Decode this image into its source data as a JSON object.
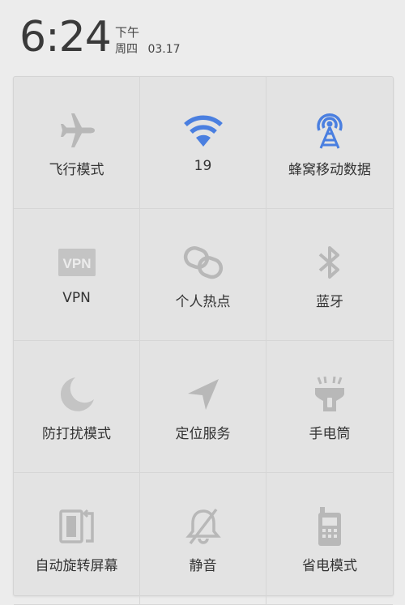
{
  "status": {
    "time": "6:24",
    "ampm": "下午",
    "weekday": "周四",
    "date": "03.17"
  },
  "colors": {
    "active": "#4a7fe0",
    "inactive": "#b8b8b8"
  },
  "tiles": [
    {
      "label": "飞行模式",
      "icon": "airplane-icon",
      "active": false
    },
    {
      "label": "19",
      "icon": "wifi-icon",
      "active": true
    },
    {
      "label": "蜂窝移动数据",
      "icon": "cellular-tower-icon",
      "active": true
    },
    {
      "label": "VPN",
      "icon": "vpn-icon",
      "active": false
    },
    {
      "label": "个人热点",
      "icon": "hotspot-link-icon",
      "active": false
    },
    {
      "label": "蓝牙",
      "icon": "bluetooth-icon",
      "active": false
    },
    {
      "label": "防打扰模式",
      "icon": "moon-icon",
      "active": false
    },
    {
      "label": "定位服务",
      "icon": "location-arrow-icon",
      "active": false
    },
    {
      "label": "手电筒",
      "icon": "flashlight-icon",
      "active": false
    },
    {
      "label": "自动旋转屏幕",
      "icon": "rotate-screen-icon",
      "active": false
    },
    {
      "label": "静音",
      "icon": "bell-muted-icon",
      "active": false
    },
    {
      "label": "省电模式",
      "icon": "battery-saver-icon",
      "active": false
    }
  ]
}
